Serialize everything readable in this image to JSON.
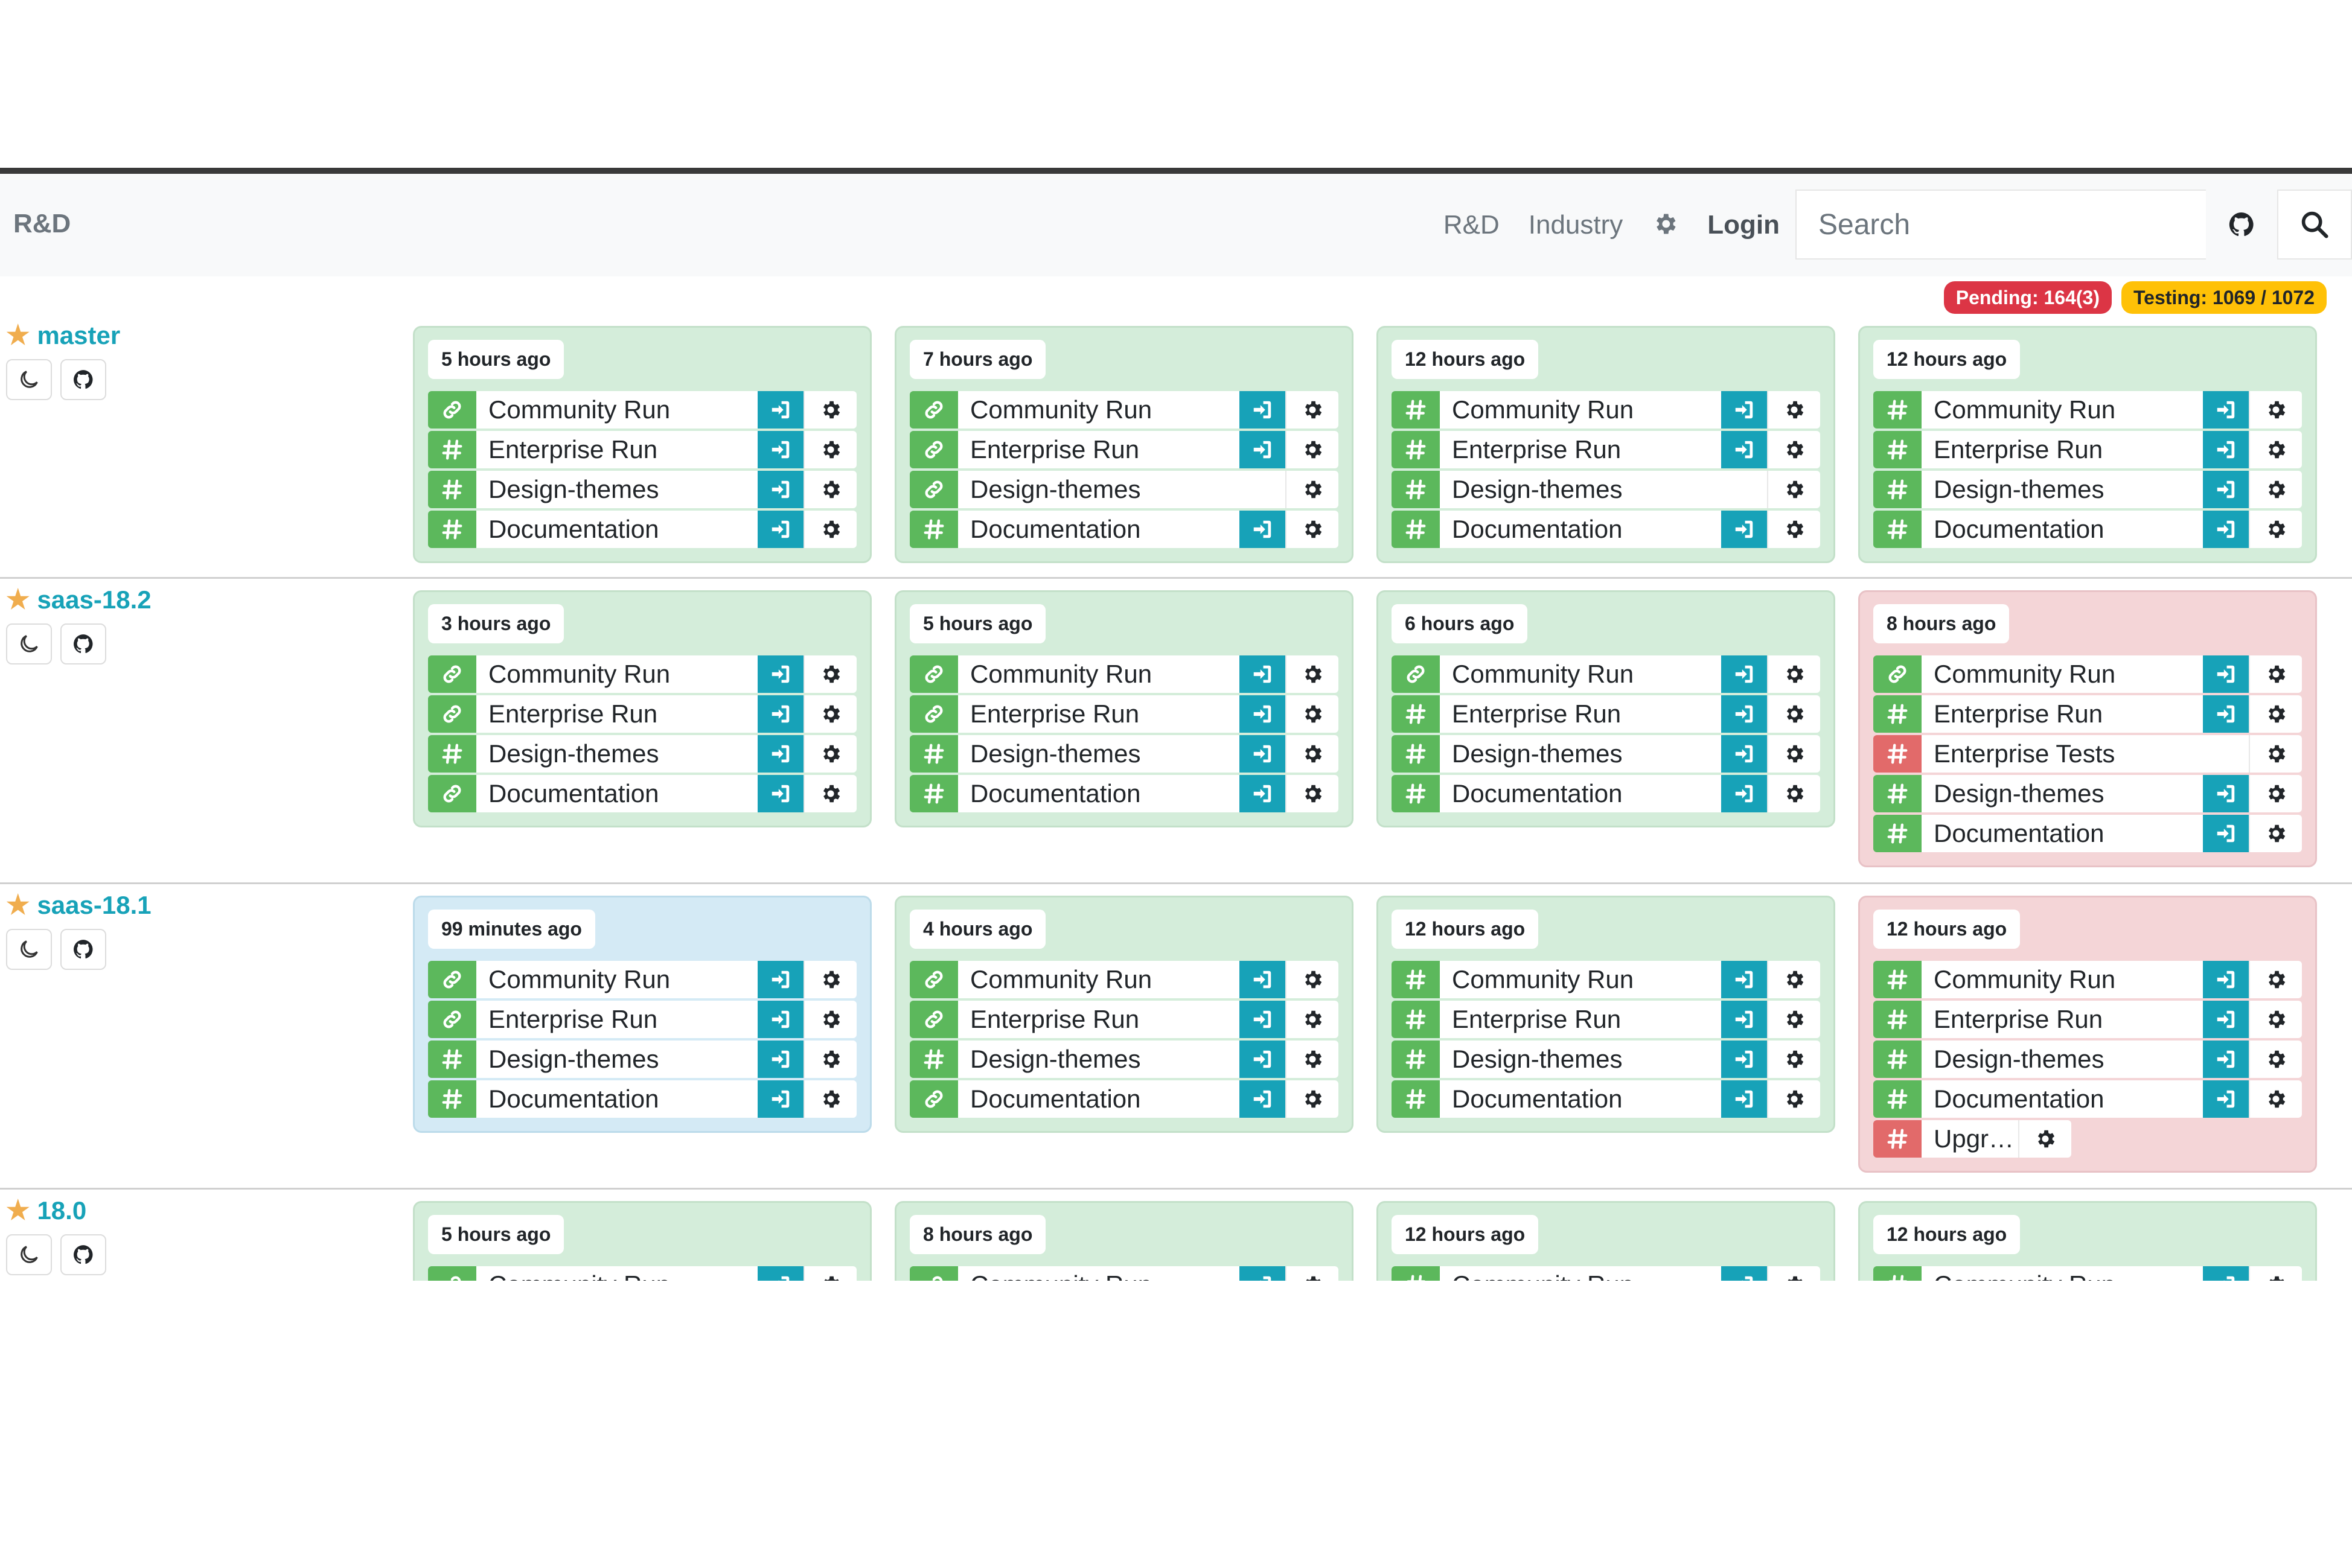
{
  "navbar": {
    "brand": "R&D",
    "links": [
      "R&D",
      "Industry"
    ],
    "login": "Login",
    "search_placeholder": "Search"
  },
  "badges": {
    "pending": "Pending: 164(3)",
    "testing": "Testing: 1069 / 1072"
  },
  "colors": {
    "success": "#5cb85c",
    "failure": "#e26a6a",
    "action": "#17a2b8",
    "card_success": "#d4edda",
    "card_failure": "#f4d5d7",
    "card_running": "#d4eaf5"
  },
  "branches": [
    {
      "name": "master",
      "batches": [
        {
          "date": "5 hours ago",
          "status": "success",
          "builds": [
            {
              "icon": "link",
              "state": "ok",
              "label": "Community Run",
              "go": true
            },
            {
              "icon": "hash",
              "state": "ok",
              "label": "Enterprise Run",
              "go": true
            },
            {
              "icon": "hash",
              "state": "ok",
              "label": "Design-themes",
              "go": true
            },
            {
              "icon": "hash",
              "state": "ok",
              "label": "Documentation",
              "go": true
            }
          ]
        },
        {
          "date": "7 hours ago",
          "status": "success",
          "builds": [
            {
              "icon": "link",
              "state": "ok",
              "label": "Community Run",
              "go": true
            },
            {
              "icon": "link",
              "state": "ok",
              "label": "Enterprise Run",
              "go": true
            },
            {
              "icon": "link",
              "state": "ok",
              "label": "Design-themes",
              "go": false
            },
            {
              "icon": "hash",
              "state": "ok",
              "label": "Documentation",
              "go": true
            }
          ]
        },
        {
          "date": "12 hours ago",
          "status": "success",
          "builds": [
            {
              "icon": "hash",
              "state": "ok",
              "label": "Community Run",
              "go": true
            },
            {
              "icon": "hash",
              "state": "ok",
              "label": "Enterprise Run",
              "go": true
            },
            {
              "icon": "hash",
              "state": "ok",
              "label": "Design-themes",
              "go": false
            },
            {
              "icon": "hash",
              "state": "ok",
              "label": "Documentation",
              "go": true
            }
          ]
        },
        {
          "date": "12 hours ago",
          "status": "success",
          "builds": [
            {
              "icon": "hash",
              "state": "ok",
              "label": "Community Run",
              "go": true
            },
            {
              "icon": "hash",
              "state": "ok",
              "label": "Enterprise Run",
              "go": true
            },
            {
              "icon": "hash",
              "state": "ok",
              "label": "Design-themes",
              "go": true
            },
            {
              "icon": "hash",
              "state": "ok",
              "label": "Documentation",
              "go": true
            }
          ]
        }
      ]
    },
    {
      "name": "saas-18.2",
      "batches": [
        {
          "date": "3 hours ago",
          "status": "success",
          "builds": [
            {
              "icon": "link",
              "state": "ok",
              "label": "Community Run",
              "go": true
            },
            {
              "icon": "link",
              "state": "ok",
              "label": "Enterprise Run",
              "go": true
            },
            {
              "icon": "hash",
              "state": "ok",
              "label": "Design-themes",
              "go": true
            },
            {
              "icon": "link",
              "state": "ok",
              "label": "Documentation",
              "go": true
            }
          ]
        },
        {
          "date": "5 hours ago",
          "status": "success",
          "builds": [
            {
              "icon": "link",
              "state": "ok",
              "label": "Community Run",
              "go": true
            },
            {
              "icon": "link",
              "state": "ok",
              "label": "Enterprise Run",
              "go": true
            },
            {
              "icon": "hash",
              "state": "ok",
              "label": "Design-themes",
              "go": true
            },
            {
              "icon": "hash",
              "state": "ok",
              "label": "Documentation",
              "go": true
            }
          ]
        },
        {
          "date": "6 hours ago",
          "status": "success",
          "builds": [
            {
              "icon": "link",
              "state": "ok",
              "label": "Community Run",
              "go": true
            },
            {
              "icon": "hash",
              "state": "ok",
              "label": "Enterprise Run",
              "go": true
            },
            {
              "icon": "hash",
              "state": "ok",
              "label": "Design-themes",
              "go": true
            },
            {
              "icon": "hash",
              "state": "ok",
              "label": "Documentation",
              "go": true
            }
          ]
        },
        {
          "date": "8 hours ago",
          "status": "failure",
          "builds": [
            {
              "icon": "link",
              "state": "ok",
              "label": "Community Run",
              "go": true
            },
            {
              "icon": "hash",
              "state": "ok",
              "label": "Enterprise Run",
              "go": true
            },
            {
              "icon": "hash",
              "state": "err",
              "label": "Enterprise Tests",
              "go": false
            },
            {
              "icon": "hash",
              "state": "ok",
              "label": "Design-themes",
              "go": true
            },
            {
              "icon": "hash",
              "state": "ok",
              "label": "Documentation",
              "go": true
            }
          ]
        }
      ]
    },
    {
      "name": "saas-18.1",
      "batches": [
        {
          "date": "99 minutes ago",
          "status": "running",
          "builds": [
            {
              "icon": "link",
              "state": "ok",
              "label": "Community Run",
              "go": true
            },
            {
              "icon": "link",
              "state": "ok",
              "label": "Enterprise Run",
              "go": true
            },
            {
              "icon": "hash",
              "state": "ok",
              "label": "Design-themes",
              "go": true
            },
            {
              "icon": "hash",
              "state": "ok",
              "label": "Documentation",
              "go": true
            }
          ]
        },
        {
          "date": "4 hours ago",
          "status": "success",
          "builds": [
            {
              "icon": "link",
              "state": "ok",
              "label": "Community Run",
              "go": true
            },
            {
              "icon": "link",
              "state": "ok",
              "label": "Enterprise Run",
              "go": true
            },
            {
              "icon": "hash",
              "state": "ok",
              "label": "Design-themes",
              "go": true
            },
            {
              "icon": "link",
              "state": "ok",
              "label": "Documentation",
              "go": true
            }
          ]
        },
        {
          "date": "12 hours ago",
          "status": "success",
          "builds": [
            {
              "icon": "hash",
              "state": "ok",
              "label": "Community Run",
              "go": true
            },
            {
              "icon": "hash",
              "state": "ok",
              "label": "Enterprise Run",
              "go": true
            },
            {
              "icon": "hash",
              "state": "ok",
              "label": "Design-themes",
              "go": true
            },
            {
              "icon": "hash",
              "state": "ok",
              "label": "Documentation",
              "go": true
            }
          ]
        },
        {
          "date": "12 hours ago",
          "status": "failure",
          "builds": [
            {
              "icon": "hash",
              "state": "ok",
              "label": "Community Run",
              "go": true
            },
            {
              "icon": "hash",
              "state": "ok",
              "label": "Enterprise Run",
              "go": true
            },
            {
              "icon": "hash",
              "state": "ok",
              "label": "Design-themes",
              "go": true
            },
            {
              "icon": "hash",
              "state": "ok",
              "label": "Documentation",
              "go": true
            },
            {
              "icon": "hash",
              "state": "err",
              "label": "Upgr…",
              "go": false,
              "short": true
            }
          ]
        }
      ]
    },
    {
      "name": "18.0",
      "batches": [
        {
          "date": "5 hours ago",
          "status": "success",
          "builds": [
            {
              "icon": "link",
              "state": "ok",
              "label": "Community Run",
              "go": true
            }
          ]
        },
        {
          "date": "8 hours ago",
          "status": "success",
          "builds": [
            {
              "icon": "link",
              "state": "ok",
              "label": "Community Run",
              "go": true
            }
          ]
        },
        {
          "date": "12 hours ago",
          "status": "success",
          "builds": [
            {
              "icon": "hash",
              "state": "ok",
              "label": "Community Run",
              "go": true
            }
          ]
        },
        {
          "date": "12 hours ago",
          "status": "success",
          "builds": [
            {
              "icon": "hash",
              "state": "ok",
              "label": "Community Run",
              "go": true
            }
          ]
        }
      ]
    }
  ]
}
